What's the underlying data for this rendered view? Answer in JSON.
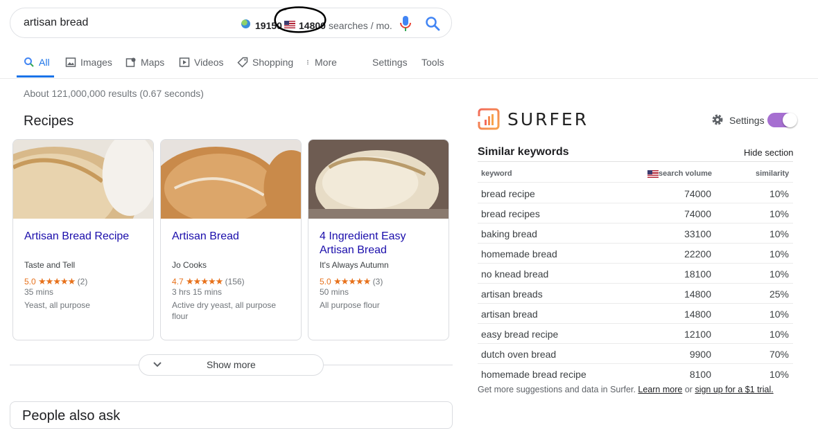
{
  "search": {
    "query": "artisan bread",
    "global_volume": "19150",
    "us_volume": "14800",
    "volume_suffix": "searches / mo."
  },
  "tabs": [
    {
      "label": "All",
      "icon": "search-icon",
      "active": true
    },
    {
      "label": "Images",
      "icon": "image-icon"
    },
    {
      "label": "Maps",
      "icon": "map-icon"
    },
    {
      "label": "Videos",
      "icon": "video-icon"
    },
    {
      "label": "Shopping",
      "icon": "tag-icon"
    },
    {
      "label": "More",
      "icon": "more-vert-icon"
    },
    {
      "label": "Settings"
    },
    {
      "label": "Tools"
    }
  ],
  "result_stats": "About 121,000,000 results (0.67 seconds)",
  "recipes": {
    "heading": "Recipes",
    "cards": [
      {
        "title": "Artisan Bread Recipe",
        "source": "Taste and Tell",
        "rating": "5.0",
        "stars": "★★★★★",
        "reviews": "(2)",
        "time": "35 mins",
        "ingredients": "Yeast, all purpose"
      },
      {
        "title": "Artisan Bread",
        "source": "Jo Cooks",
        "rating": "4.7",
        "stars": "★★★★★",
        "reviews": "(156)",
        "time": "3 hrs 15 mins",
        "ingredients": "Active dry yeast, all purpose flour"
      },
      {
        "title": "4 Ingredient Easy Artisan Bread",
        "source": "It's Always Autumn",
        "rating": "5.0",
        "stars": "★★★★★",
        "reviews": "(3)",
        "time": "50 mins",
        "ingredients": "All purpose flour"
      }
    ],
    "show_more": "Show more"
  },
  "next_section": "People also ask",
  "surfer": {
    "brand": "SURFER",
    "settings_label": "Settings",
    "toggle_on": true,
    "title": "Similar keywords",
    "hide_label": "Hide section",
    "columns": {
      "keyword": "keyword",
      "volume": "search volume",
      "similarity": "similarity"
    },
    "rows": [
      {
        "keyword": "bread recipe",
        "volume": "74000",
        "similarity": "10%"
      },
      {
        "keyword": "bread recipes",
        "volume": "74000",
        "similarity": "10%"
      },
      {
        "keyword": "baking bread",
        "volume": "33100",
        "similarity": "10%"
      },
      {
        "keyword": "homemade bread",
        "volume": "22200",
        "similarity": "10%"
      },
      {
        "keyword": "no knead bread",
        "volume": "18100",
        "similarity": "10%"
      },
      {
        "keyword": "artisan breads",
        "volume": "14800",
        "similarity": "25%"
      },
      {
        "keyword": "artisan bread",
        "volume": "14800",
        "similarity": "10%"
      },
      {
        "keyword": "easy bread recipe",
        "volume": "12100",
        "similarity": "10%"
      },
      {
        "keyword": "dutch oven bread",
        "volume": "9900",
        "similarity": "70%"
      },
      {
        "keyword": "homemade bread recipe",
        "volume": "8100",
        "similarity": "10%"
      }
    ],
    "footer": {
      "text": "Get more suggestions and data in Surfer.",
      "learn_more": "Learn more",
      "or": "or",
      "trial": "sign up for a $1 trial."
    }
  },
  "colors": {
    "link": "#1a0dab",
    "accent": "#1a73e8",
    "rating": "#e7711b",
    "toggle": "#a66fd1"
  }
}
